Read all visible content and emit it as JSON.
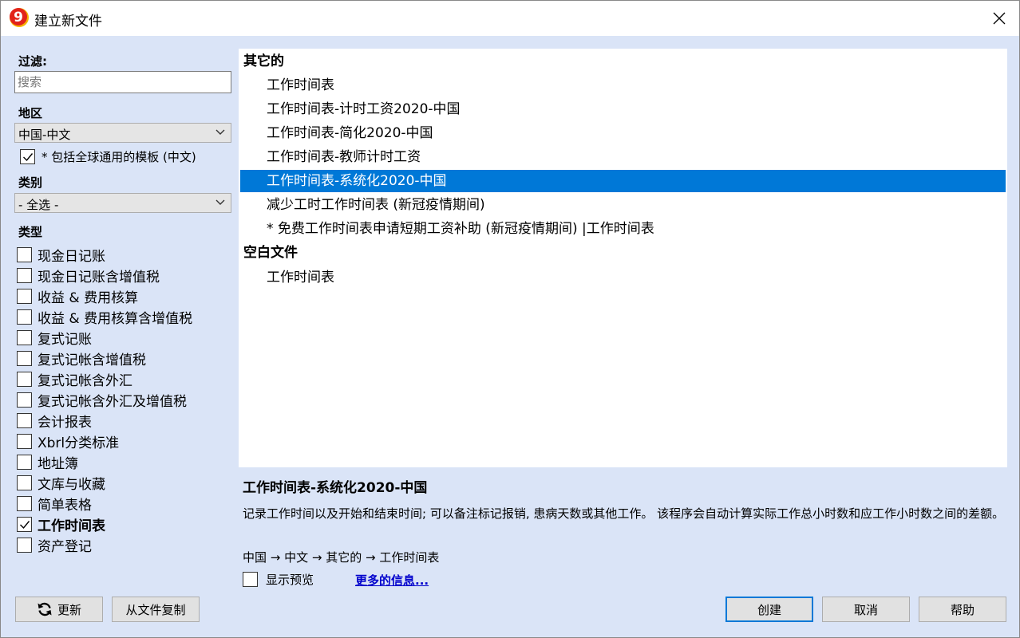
{
  "window": {
    "title": "建立新文件",
    "app_icon_glyph": "9",
    "accent_color": "#0078d7"
  },
  "filter": {
    "label": "过滤:",
    "search_placeholder": "搜索",
    "search_value": ""
  },
  "region": {
    "label": "地区",
    "selected": "中国-中文",
    "include_global_label": "* 包括全球通用的模板 (中文)",
    "include_global_checked": true
  },
  "category": {
    "label": "类别",
    "selected": "- 全选 -"
  },
  "types": {
    "label": "类型",
    "items": [
      {
        "label": "现金日记账",
        "checked": false
      },
      {
        "label": "现金日记账含增值税",
        "checked": false
      },
      {
        "label": "收益 & 费用核算",
        "checked": false
      },
      {
        "label": "收益 & 费用核算含增值税",
        "checked": false
      },
      {
        "label": "复式记账",
        "checked": false
      },
      {
        "label": "复式记帐含增值税",
        "checked": false
      },
      {
        "label": "复式记帐含外汇",
        "checked": false
      },
      {
        "label": "复式记帐含外汇及增值税",
        "checked": false
      },
      {
        "label": "会计报表",
        "checked": false
      },
      {
        "label": "Xbrl分类标准",
        "checked": false
      },
      {
        "label": "地址簿",
        "checked": false
      },
      {
        "label": "文库与收藏",
        "checked": false
      },
      {
        "label": "简单表格",
        "checked": false
      },
      {
        "label": "工作时间表",
        "checked": true
      },
      {
        "label": "资产登记",
        "checked": false
      }
    ]
  },
  "templates": [
    {
      "kind": "group",
      "label": "其它的"
    },
    {
      "kind": "item",
      "label": "工作时间表"
    },
    {
      "kind": "item",
      "label": "工作时间表-计时工资2020-中国"
    },
    {
      "kind": "item",
      "label": "工作时间表-简化2020-中国"
    },
    {
      "kind": "item",
      "label": "工作时间表-教师计时工资"
    },
    {
      "kind": "item",
      "label": "工作时间表-系统化2020-中国",
      "selected": true
    },
    {
      "kind": "item",
      "label": "减少工时工作时间表 (新冠疫情期间)"
    },
    {
      "kind": "item",
      "label": "* 免费工作时间表申请短期工资补助 (新冠疫情期间) |工作时间表"
    },
    {
      "kind": "group",
      "label": "空白文件"
    },
    {
      "kind": "item",
      "label": "工作时间表"
    }
  ],
  "details": {
    "title": "工作时间表-系统化2020-中国",
    "description": "记录工作时间以及开始和结束时间; 可以备注标记报销, 患病天数或其他工作。 该程序会自动计算实际工作总小时数和应工作小时数之间的差额。",
    "path": "中国 → 中文 → 其它的 → 工作时间表",
    "show_preview_label": "显示预览",
    "show_preview_checked": false,
    "more_info_label": "更多的信息..."
  },
  "buttons": {
    "update": "更新",
    "copy_from_file": "从文件复制",
    "create": "创建",
    "cancel": "取消",
    "help": "帮助"
  }
}
